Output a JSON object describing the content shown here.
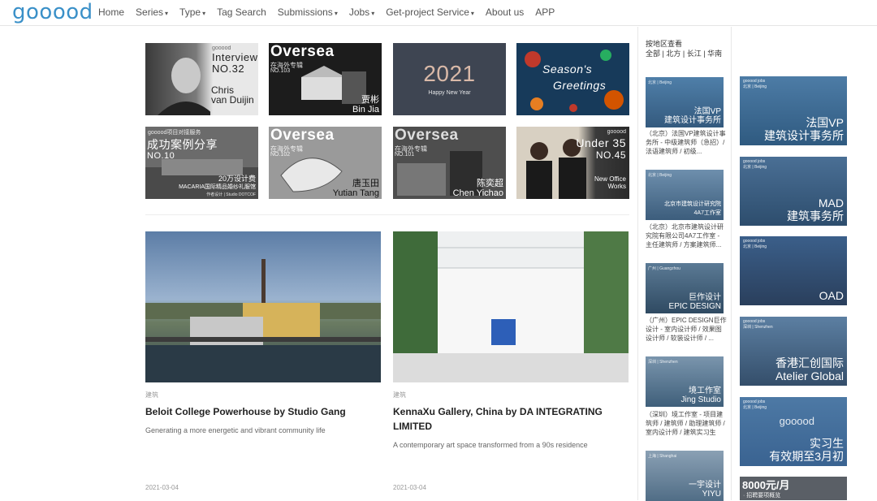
{
  "nav": {
    "logo": "gooood",
    "items": [
      "Home",
      "Series",
      "Type",
      "Tag Search",
      "Submissions",
      "Jobs",
      "Get-project Service",
      "About us",
      "APP"
    ],
    "caret": "▾"
  },
  "thumbs": [
    {
      "small": "gooood",
      "big": "Interview",
      "big2": "NO.32",
      "name": "Chris",
      "name2": "van Duijin"
    },
    {
      "big": "Oversea",
      "small": "在海外专辑",
      "small2": "NO.103",
      "name": "贾彬",
      "name2": "Bin Jia"
    },
    {
      "big": "2021",
      "small": "Happy New Year"
    },
    {
      "big": "Season's",
      "big2": "Greetings"
    },
    {
      "small": "gooood项目对接服务",
      "big": "成功案例分享",
      "big2": "NO.10",
      "name": "20万设计费",
      "name2": "MACARIA国际精品婚纱礼服馆",
      "small2": "作者设计 | Studio DOTCOF"
    },
    {
      "big": "Oversea",
      "small": "在海外专辑",
      "small2": "NO.102",
      "name": "唐玉田",
      "name2": "Yutian Tang"
    },
    {
      "big": "Oversea",
      "small": "在海外专辑",
      "small2": "NO.101",
      "name": "陈奕超",
      "name2": "Chen Yichao"
    },
    {
      "small": "gooood",
      "big": "Under 35",
      "big2": "NO.45",
      "name": "New Office",
      "name2": "Works"
    }
  ],
  "features": [
    {
      "category": "建筑",
      "title": "Beloit College Powerhouse by Studio Gang",
      "subtitle": "Generating a more energetic and vibrant community life",
      "date": "2021-03-04"
    },
    {
      "category": "建筑",
      "title": "KennaXu Gallery, China by DA INTEGRATING LIMITED",
      "subtitle": "A contemporary art space transformed from a 90s residence",
      "date": "2021-03-04"
    }
  ],
  "sidebar": {
    "region_title": "按地区查看",
    "regions": [
      "全部",
      "北方",
      "长江",
      "华南"
    ],
    "sep": " | ",
    "jobs": [
      {
        "city": "北京 | Beijing",
        "name": "法国VP",
        "name2": "建筑设计事务所",
        "text": "（北京）法国VP建筑设计事务所 - 中级建筑师（急招）/ 法语建筑师 / 初级..."
      },
      {
        "city": "北京 | Beijing",
        "name": "北京市建筑设计研究院",
        "name2": "4A7工作室",
        "text": "（北京）北京市建筑设计研究院有限公司4A7工作室 - 主任建筑师 / 方案建筑师..."
      },
      {
        "city": "广州 | Guangzhou",
        "name": "巨作设计",
        "name2": "EPIC DESIGN",
        "text": "（广州）EPIC DESIGN巨作设计 - 室内设计师 / 效果图设计师 / 软装设计师 / ..."
      },
      {
        "city": "深圳 | Shenzhen",
        "name": "境工作室",
        "name2": "Jing Studio",
        "text": "（深圳）境工作室 - 项目建筑师 / 建筑师 / 助理建筑师 / 室内设计师 / 建筑实习生"
      },
      {
        "city": "上海 | Shanghai",
        "name": "一宇设计",
        "name2": "YIYU",
        "text": ""
      }
    ],
    "bigjobs": [
      {
        "top": "gooood jobs",
        "city": "北京 | Beijing",
        "name": "法国VP",
        "name2": "建筑设计事务所"
      },
      {
        "top": "gooood jobs",
        "city": "北京 | Beijing",
        "name": "MAD",
        "name2": "建筑事务所"
      },
      {
        "top": "gooood jobs",
        "city": "北京 | Beijing",
        "name": "OAD",
        "name2": ""
      },
      {
        "top": "gooood jobs",
        "city": "深圳 | Shenzhen",
        "name": "香港汇创国际",
        "name2": "Atelier Global"
      },
      {
        "top": "gooood jobs",
        "city": "北京 | Beijing",
        "name": "实习生",
        "name2": "有效期至3月初",
        "mid": "gooood"
      },
      {
        "top": "",
        "city": "",
        "name": "8000元/月",
        "name2": "· 招聘要项概览"
      }
    ]
  }
}
